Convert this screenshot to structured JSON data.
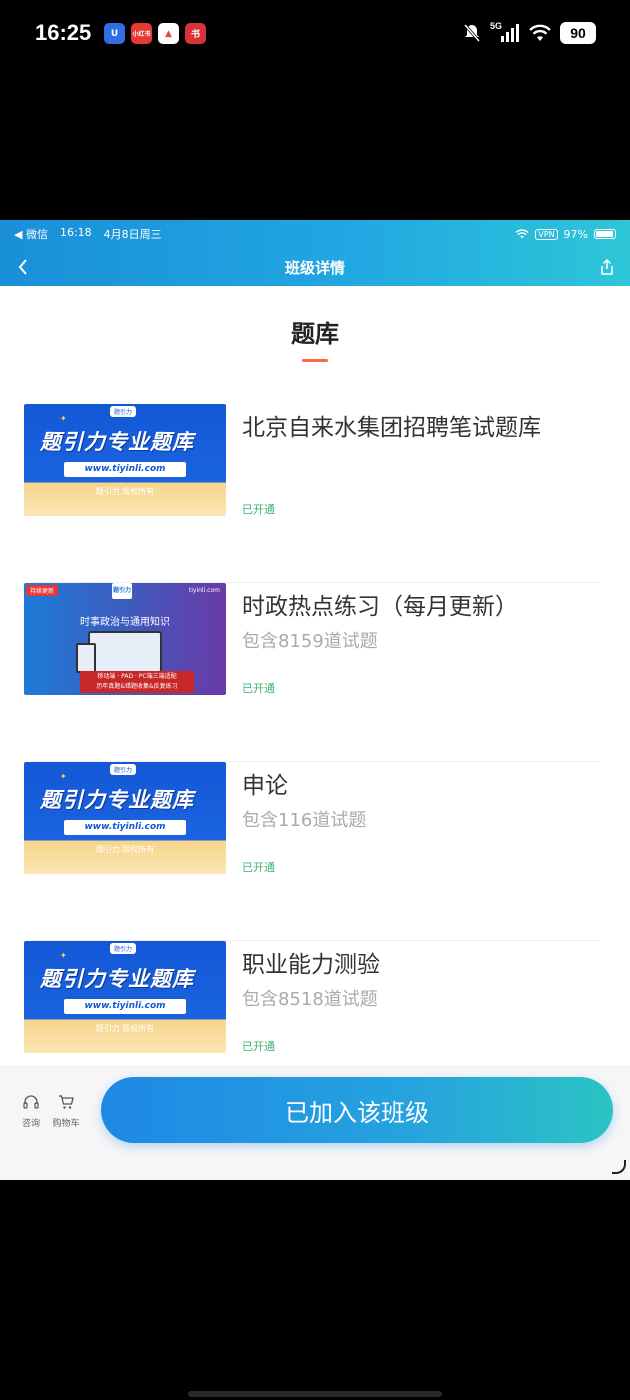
{
  "os_status": {
    "time": "16:25",
    "network": "5G",
    "battery": "90",
    "apps": [
      {
        "icon": "uu-app-icon",
        "glyph": "U",
        "color": "#2f6ee5"
      },
      {
        "icon": "xiaohongshu-icon",
        "glyph": "小红书",
        "color": "#e53935"
      },
      {
        "icon": "triangle-app-icon",
        "glyph": "▲",
        "color": "#e84a3c"
      },
      {
        "icon": "redbook-app-icon",
        "glyph": "书",
        "color": "#d9323a"
      }
    ]
  },
  "inner_status": {
    "back_app": "◀ 微信",
    "time": "16:18",
    "date": "4月8日周三",
    "vpn": "VPN",
    "battery": "97%"
  },
  "nav": {
    "title": "班级详情"
  },
  "section": {
    "title": "题库"
  },
  "thumbnail_text": {
    "brand": "题引力",
    "headline": "题引力专业题库",
    "url": "www.tiyinli.com",
    "copyright": "题引力 版权所有",
    "b_tag": "持续更新",
    "b_site": "tiyinli.com",
    "b_badge": "题引力",
    "b_head": "时事政治与通用知识",
    "b_line1": "移动端 · PAD · PC端三端适配",
    "b_line2": "历年真题&错题收集&反复练习"
  },
  "items": [
    {
      "title": "北京自来水集团招聘笔试题库",
      "subtitle": "",
      "status": "已开通"
    },
    {
      "title": "时政热点练习（每月更新）",
      "subtitle": "包含8159道试题",
      "status": "已开通"
    },
    {
      "title": "申论",
      "subtitle": "包含116道试题",
      "status": "已开通"
    },
    {
      "title": "职业能力测验",
      "subtitle": "包含8518道试题",
      "status": "已开通"
    }
  ],
  "bottom": {
    "consult_label": "咨询",
    "cart_label": "购物车",
    "cta_label": "已加入该班级"
  },
  "colors": {
    "accent_blue": "#1e88e5",
    "underline_orange": "#ff6b3d",
    "status_green": "#3cb371"
  }
}
